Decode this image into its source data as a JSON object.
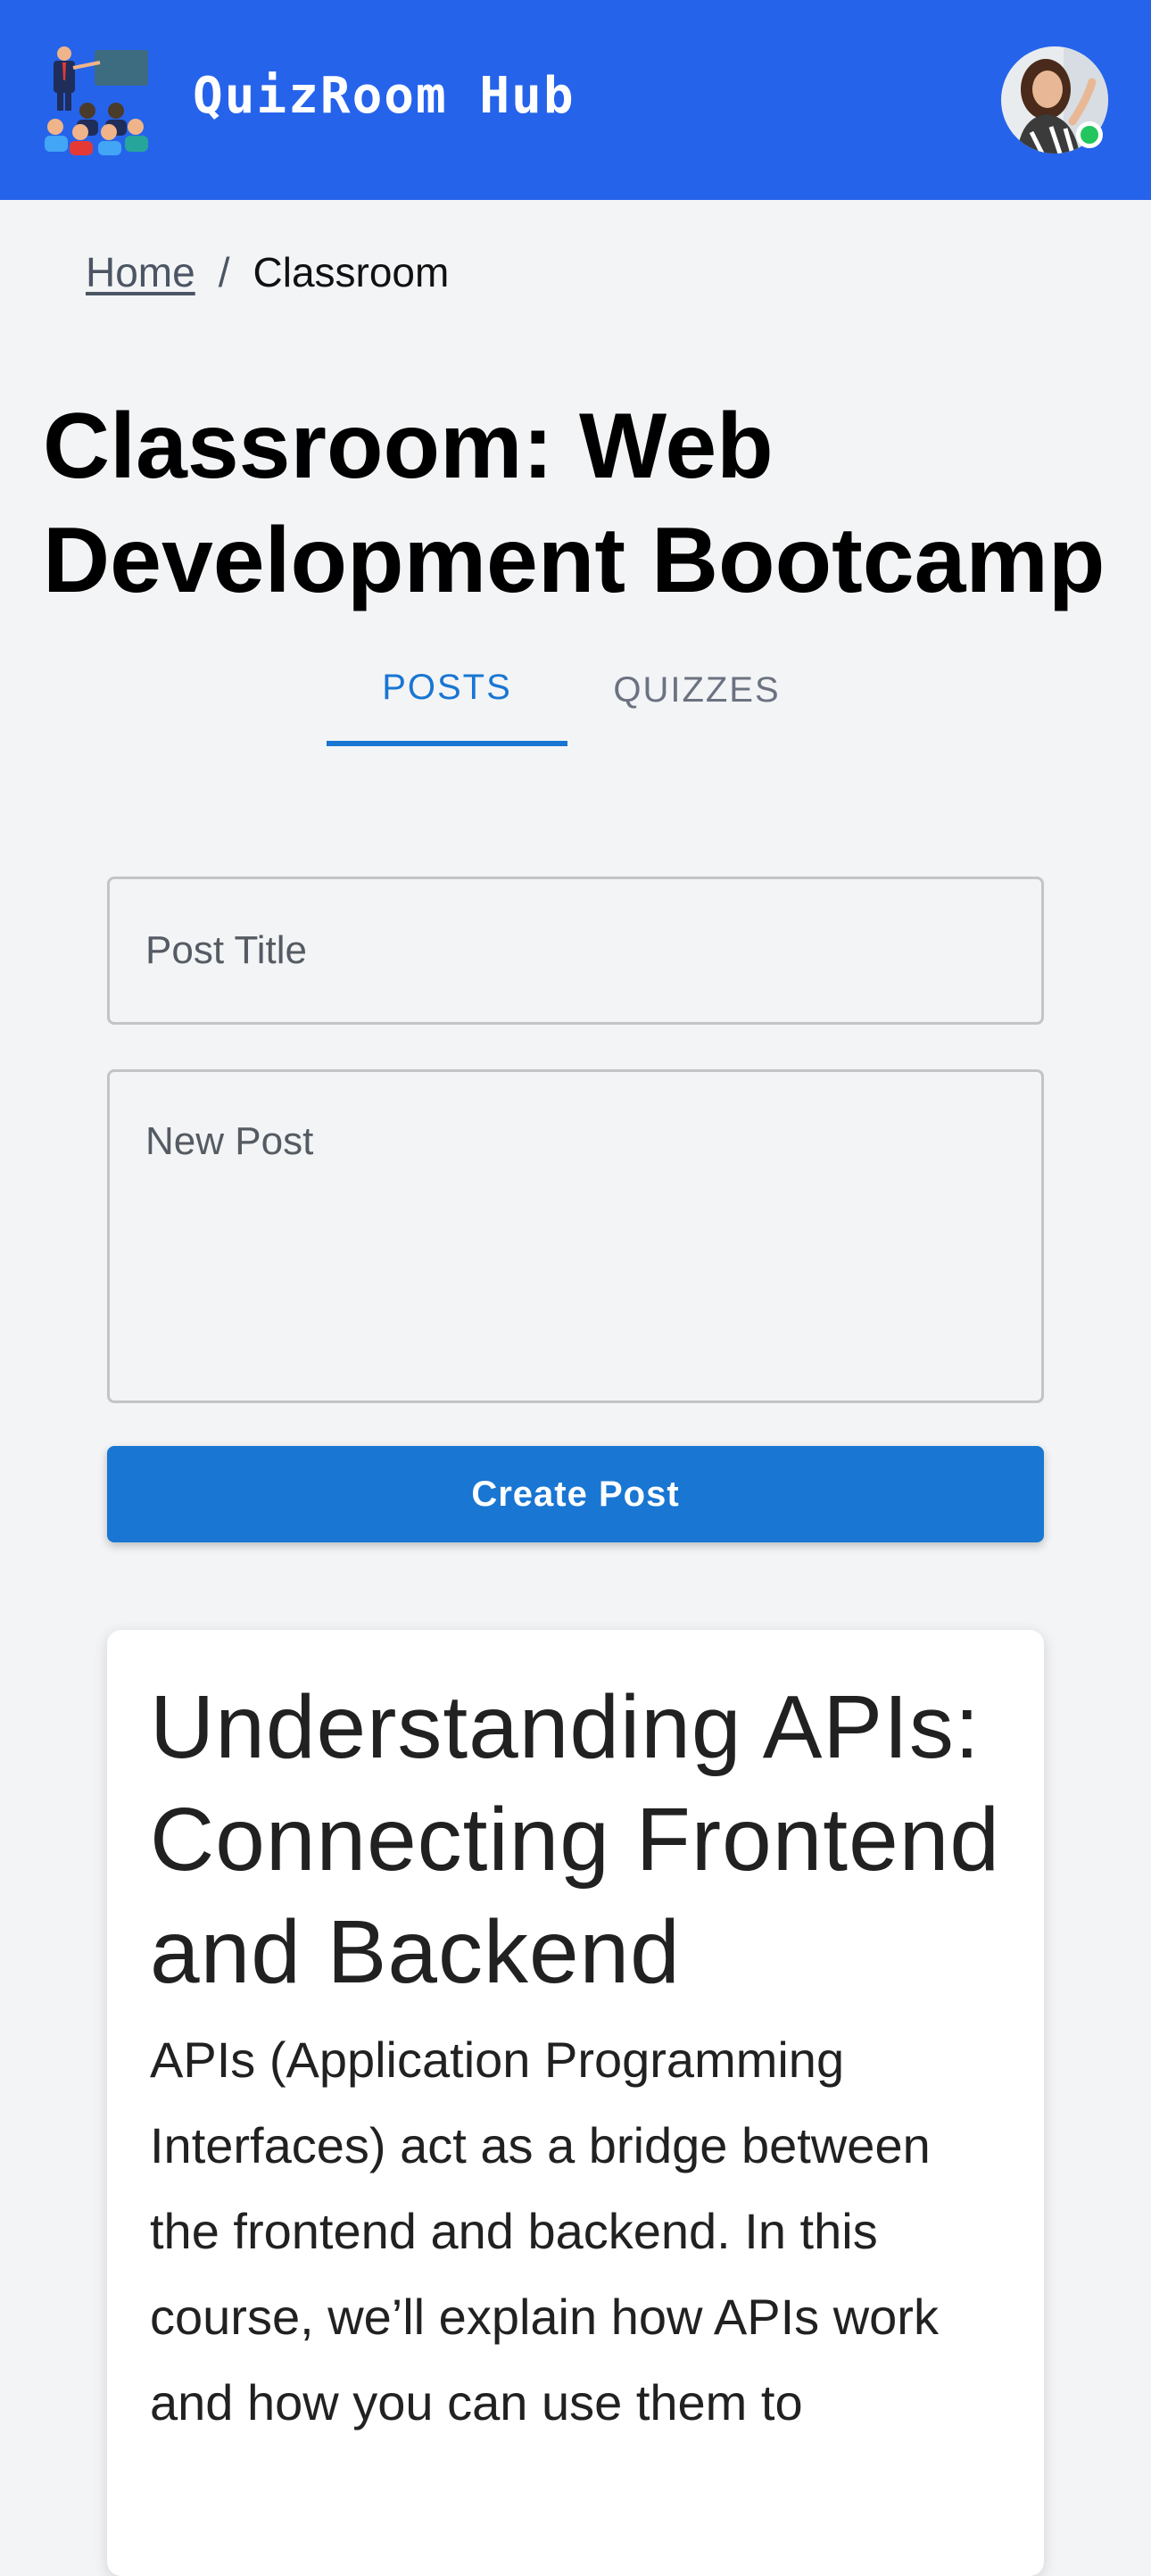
{
  "header": {
    "app_title": "QuizRoom Hub",
    "logo_icon": "classroom-teacher-logo",
    "avatar_alt": "User avatar",
    "status": "online",
    "colors": {
      "header_bg": "#2563eb",
      "online": "#22c55e"
    }
  },
  "breadcrumb": {
    "home": "Home",
    "separator": "/",
    "current": "Classroom"
  },
  "page": {
    "title": "Classroom: Web Development Bootcamp"
  },
  "tabs": [
    {
      "label": "POSTS",
      "active": true
    },
    {
      "label": "QUIZZES",
      "active": false
    }
  ],
  "form": {
    "title_placeholder": "Post Title",
    "title_value": "",
    "content_placeholder": "New Post",
    "content_value": "",
    "submit_label": "Create Post",
    "accent": "#1976d2"
  },
  "posts": [
    {
      "title": "Understanding APIs: Connecting Frontend and Backend",
      "body": "APIs (Application Programming Interfaces) act as a bridge between the frontend and backend. In this course, we’ll explain how APIs work and how you can use them to"
    }
  ]
}
